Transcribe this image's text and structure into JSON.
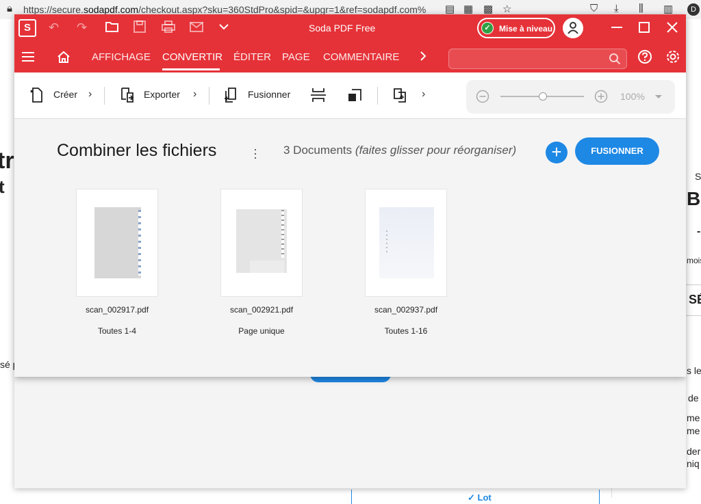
{
  "browser": {
    "url_prefix": "https://secure.",
    "url_host": "sodapdf.com",
    "url_rest": "/checkout.aspx?sku=360StdPro&spid=&upgr=1&ref=sodapdf.com%"
  },
  "background": {
    "left_fragments": [
      "tr",
      "t",
      "sé p"
    ],
    "right_fragments": [
      "S",
      "BU",
      "-",
      "mois",
      "SÉ",
      "s les",
      "de",
      "me",
      "me",
      "der",
      "niq"
    ],
    "bottom_link": "✓ Lot"
  },
  "app": {
    "title": "Soda PDF Free",
    "logo_letter": "S",
    "upgrade_label": "Mise à niveau",
    "tabs": [
      {
        "label": "AFFICHAGE"
      },
      {
        "label": "CONVERTIR"
      },
      {
        "label": "ÉDITER"
      },
      {
        "label": "PAGE"
      },
      {
        "label": "COMMENTAIRE"
      }
    ],
    "active_tab": "CONVERTIR",
    "search_placeholder": ""
  },
  "toolbar": {
    "create_label": "Créer",
    "export_label": "Exporter",
    "merge_label": "Fusionner",
    "zoom_value": "100%"
  },
  "content": {
    "title": "Combiner les fichiers",
    "doc_count": "3 Documents",
    "doc_hint": "(faites glisser pour réorganiser)",
    "merge_button": "FUSIONNER",
    "documents": [
      {
        "name": "scan_002917.pdf",
        "pages": "Toutes 1-4"
      },
      {
        "name": "scan_002921.pdf",
        "pages": "Page unique"
      },
      {
        "name": "scan_002937.pdf",
        "pages": "Toutes 1-16"
      }
    ]
  },
  "colors": {
    "brand_red": "#e53238",
    "accent_blue": "#1e88e5",
    "upgrade_green": "#2ea043"
  }
}
